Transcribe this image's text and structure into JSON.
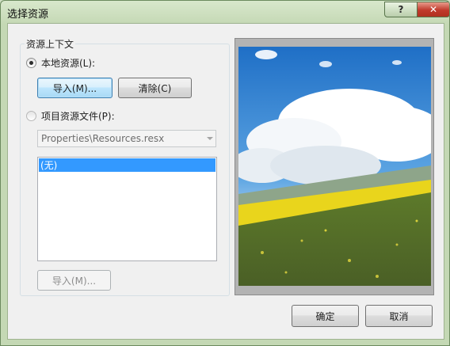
{
  "window": {
    "title": "选择资源",
    "help_glyph": "?",
    "close_glyph": "✕"
  },
  "group": {
    "legend": "资源上下文"
  },
  "local": {
    "radio_label": "本地资源(L):",
    "import_label": "导入(M)...",
    "clear_label": "清除(C)"
  },
  "project": {
    "radio_label": "项目资源文件(P):",
    "combo_value": "Properties\\Resources.resx",
    "list_items": [
      "(无)"
    ],
    "import_label": "导入(M)..."
  },
  "footer": {
    "ok_label": "确定",
    "cancel_label": "取消"
  },
  "colors": {
    "selection": "#3399ff",
    "sky": "#2f7fcf",
    "rapeseed": "#e6d21a",
    "field": "#556b2f"
  }
}
